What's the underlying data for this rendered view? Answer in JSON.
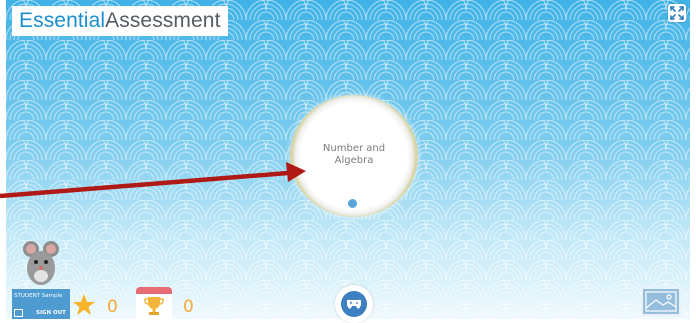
{
  "app": {
    "logo_part1": "Essential",
    "logo_part2": "Assessment"
  },
  "main": {
    "topic": "Number and Algebra"
  },
  "user": {
    "name": "STUDENT Sample",
    "sign_out_label": "SIGN OUT"
  },
  "stats": {
    "stars": "0",
    "trophies": "0"
  },
  "colors": {
    "brand_blue": "#1a8fd0",
    "arrow_red": "#b01a16",
    "star_gold": "#f5b42a",
    "count_orange": "#f2a83a"
  },
  "icons": [
    "fullscreen-icon",
    "mouse-mascot-icon",
    "sign-out-icon",
    "star-icon",
    "trophy-icon",
    "gamepad-icon",
    "landscape-icon"
  ]
}
